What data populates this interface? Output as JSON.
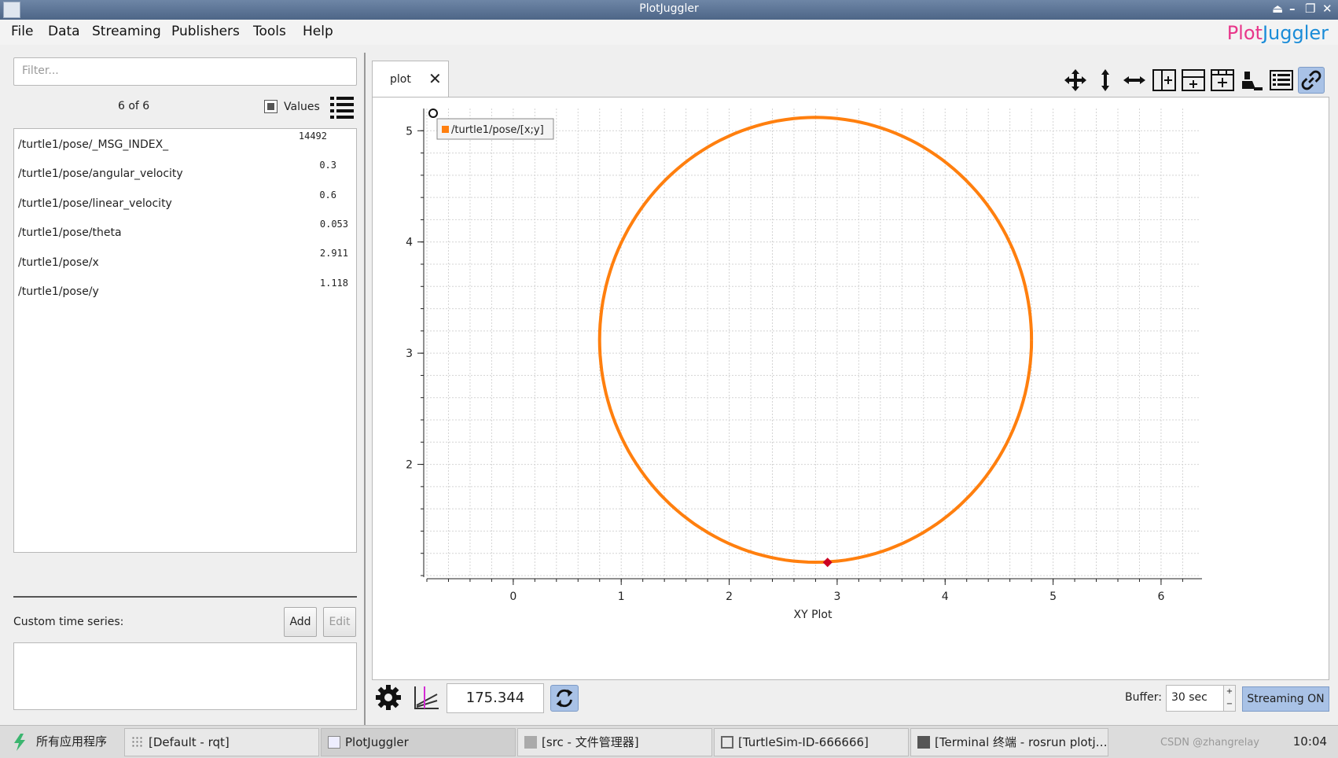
{
  "window": {
    "title": "PlotJuggler"
  },
  "menu": [
    "File",
    "Data",
    "Streaming",
    "Publishers",
    "Tools",
    "Help"
  ],
  "brand": {
    "part1": "Plot",
    "part2": "Juggler"
  },
  "left_panel": {
    "filter_placeholder": "Filter...",
    "count": "6 of 6",
    "values_label": "Values",
    "topics": [
      {
        "name": "/turtle1/pose/_MSG_INDEX_",
        "value": "14492"
      },
      {
        "name": "/turtle1/pose/angular_velocity",
        "value": "0.3"
      },
      {
        "name": "/turtle1/pose/linear_velocity",
        "value": "0.6"
      },
      {
        "name": "/turtle1/pose/theta",
        "value": "0.053"
      },
      {
        "name": "/turtle1/pose/x",
        "value": "2.911"
      },
      {
        "name": "/turtle1/pose/y",
        "value": "1.118"
      }
    ],
    "custom_label": "Custom time series:",
    "add_label": "Add",
    "edit_label": "Edit"
  },
  "tab": {
    "label": "plot"
  },
  "toolbar_icons": [
    "move-icon",
    "zoom-vertical-icon",
    "zoom-horizontal-icon",
    "split-horizontal-icon",
    "split-vertical-icon",
    "add-grid-icon",
    "clear-icon",
    "legend-icon",
    "link-icon"
  ],
  "bottom": {
    "time_value": "175.344",
    "buffer_label": "Buffer:",
    "buffer_value": "30 sec",
    "streaming_label": "Streaming ON"
  },
  "chart_data": {
    "type": "scatter",
    "title": "",
    "xlabel": "XY Plot",
    "ylabel": "",
    "xlim": [
      -0.8,
      6.35
    ],
    "ylim": [
      1.0,
      5.2
    ],
    "xticks": [
      0,
      1,
      2,
      3,
      4,
      5,
      6
    ],
    "yticks": [
      2,
      3,
      4,
      5
    ],
    "grid": true,
    "legend_position": "top-left",
    "series": [
      {
        "name": "/turtle1/pose/[x;y]",
        "color": "#ff7f0e",
        "shape": "circle",
        "center": [
          2.8,
          3.12
        ],
        "radius": 2.0
      }
    ],
    "marker": {
      "x": 2.911,
      "y": 1.118,
      "color": "#cc0022"
    }
  },
  "taskbar": {
    "start_label": "所有应用程序",
    "tasks": [
      "[Default - rqt]",
      "PlotJuggler",
      "[src - 文件管理器]",
      "[TurtleSim-ID-666666]",
      "[Terminal 终端 - rosrun plotj…"
    ],
    "watermark": "CSDN @zhangrelay",
    "clock": "10:04"
  }
}
